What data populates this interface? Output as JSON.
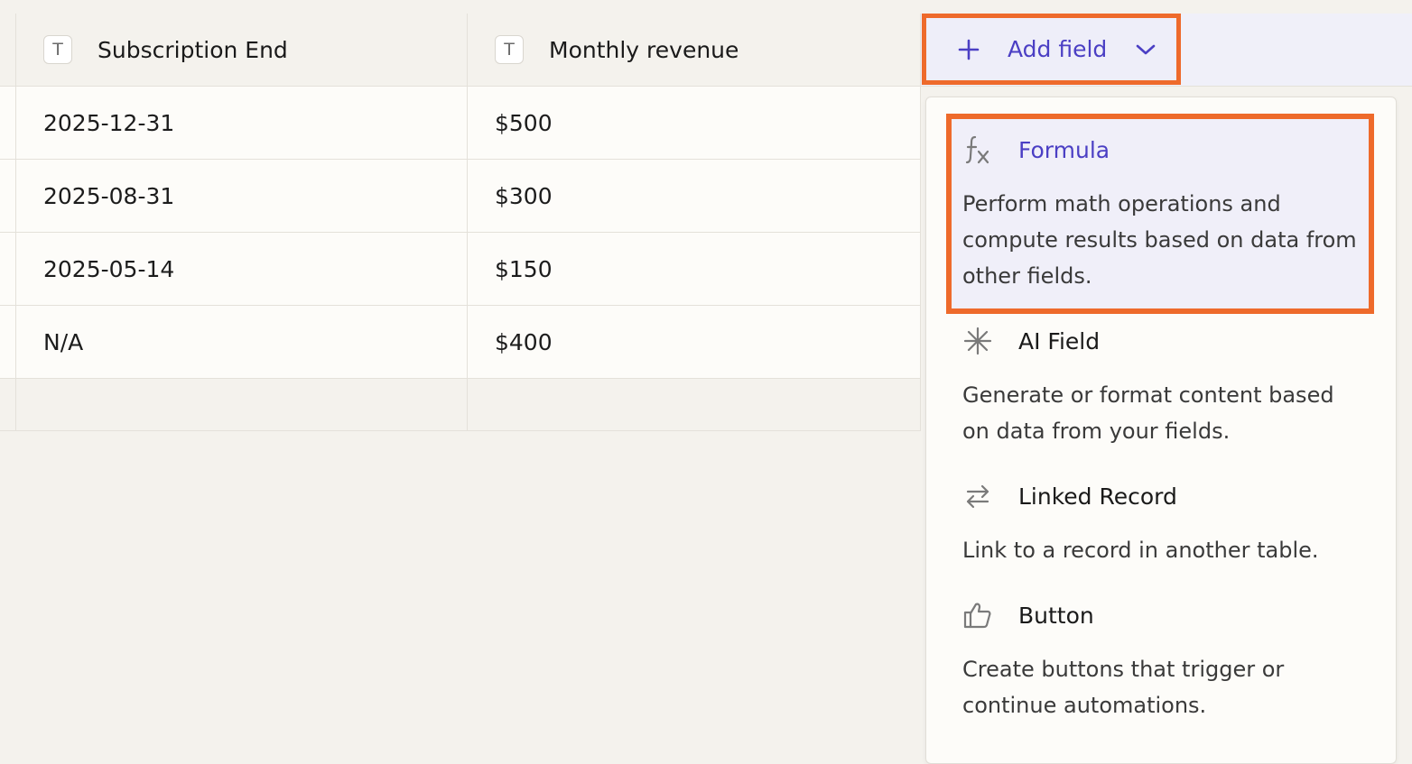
{
  "table": {
    "columns": [
      {
        "label": "Subscription End",
        "type_icon": "T"
      },
      {
        "label": "Monthly revenue",
        "type_icon": "T"
      }
    ],
    "rows": [
      [
        "2025-12-31",
        "$500"
      ],
      [
        "2025-08-31",
        "$300"
      ],
      [
        "2025-05-14",
        "$150"
      ],
      [
        "N/A",
        "$400"
      ]
    ]
  },
  "add_field": {
    "label": "Add field",
    "icon": "plus-icon",
    "dropdown_icon": "chevron-down-icon",
    "color": "#4b3fc4"
  },
  "menu": {
    "options": [
      {
        "title": "Formula",
        "icon": "function-icon",
        "description": "Perform math operations and compute results based on data from other fields."
      },
      {
        "title": "AI Field",
        "icon": "sparkle-icon",
        "description": "Generate or format content based on data from your fields."
      },
      {
        "title": "Linked Record",
        "icon": "arrows-swap-icon",
        "description": "Link to a record in another table."
      },
      {
        "title": "Button",
        "icon": "thumbs-up-icon",
        "description": "Create buttons that trigger or continue automations."
      }
    ]
  },
  "highlight_color": "#ee6a2b"
}
